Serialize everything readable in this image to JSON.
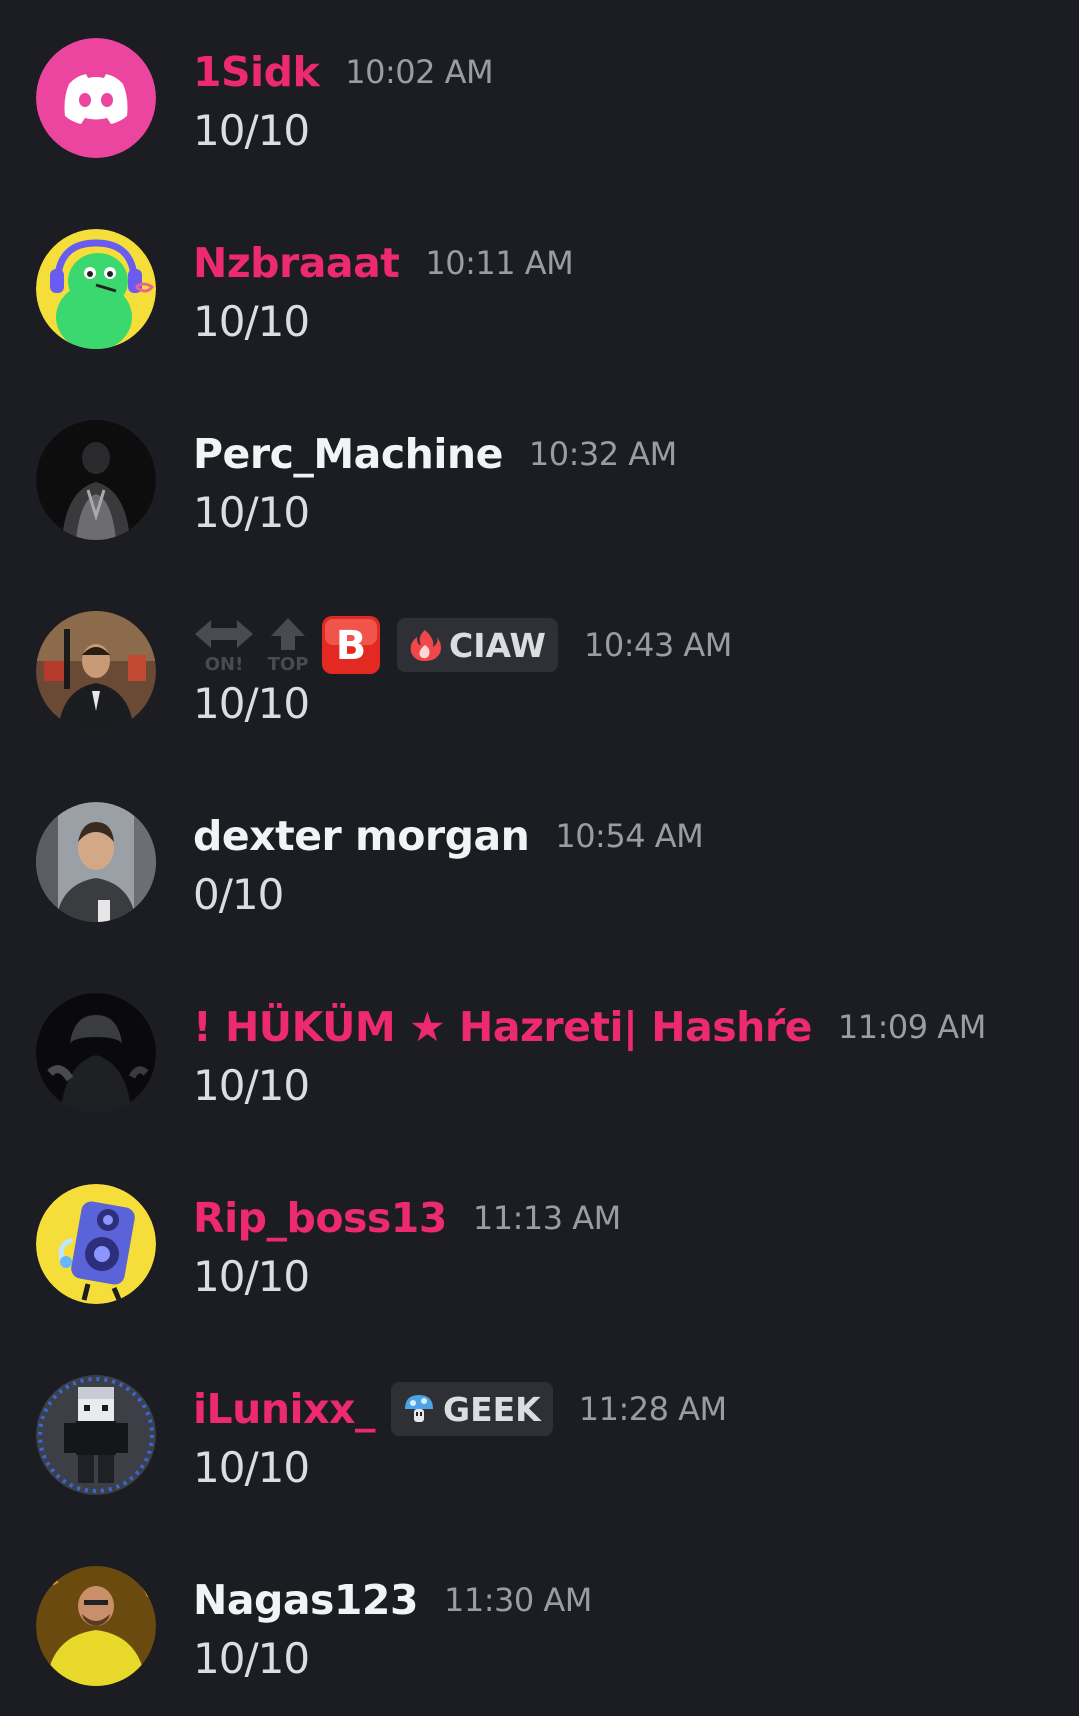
{
  "messages": [
    {
      "author": "1Sidk",
      "time": "10:02 AM",
      "content": "10/10",
      "name_color": "#ee2a6f",
      "avatar": "discord-default-avatar"
    },
    {
      "author": "Nzbraaat",
      "time": "10:11 AM",
      "content": "10/10",
      "name_color": "#ee2a6f",
      "avatar": "green-alien-headset-avatar"
    },
    {
      "author": "Perc_Machine",
      "time": "10:32 AM",
      "content": "10/10",
      "name_color": "#f2f3f5",
      "avatar": "dark-portrait-avatar"
    },
    {
      "author": "",
      "time": "10:43 AM",
      "content": "10/10",
      "name_color": "#f2f3f5",
      "avatar": "movie-scene-avatar",
      "emojis": [
        {
          "icon": "left-right-arrow-icon",
          "label": "ON!"
        },
        {
          "icon": "up-arrow-icon",
          "label": "TOP"
        },
        {
          "icon": "b-button-icon",
          "label": "B"
        }
      ],
      "tag": {
        "icon": "fire-icon",
        "label": "CIAW"
      }
    },
    {
      "author": "dexter morgan",
      "time": "10:54 AM",
      "content": "0/10",
      "name_color": "#f2f3f5",
      "avatar": "man-portrait-avatar"
    },
    {
      "author": "! HÜKÜM ★ Hazreti| Hashŕe",
      "time": "11:09 AM",
      "content": "10/10",
      "name_color": "#ee2a6f",
      "avatar": "hooded-figure-avatar"
    },
    {
      "author": "Rip_boss13",
      "time": "11:13 AM",
      "content": "10/10",
      "name_color": "#ee2a6f",
      "avatar": "blue-speaker-character-avatar"
    },
    {
      "author": "iLunixx_",
      "time": "11:28 AM",
      "content": "10/10",
      "name_color": "#ee2a6f",
      "avatar": "minecraft-skin-avatar",
      "tag": {
        "icon": "mushroom-icon",
        "label": "GEEK"
      }
    },
    {
      "author": "Nagas123",
      "time": "11:30 AM",
      "content": "10/10",
      "name_color": "#f2f3f5",
      "avatar": "yellow-suit-man-avatar"
    }
  ]
}
